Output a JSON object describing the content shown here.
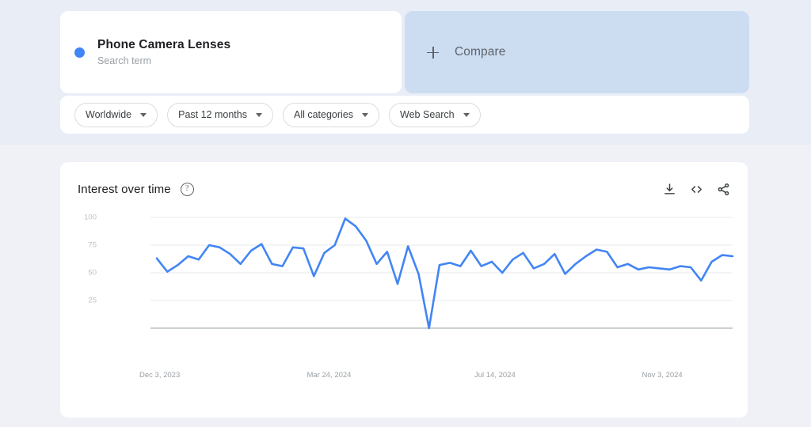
{
  "search_term": {
    "title": "Phone Camera Lenses",
    "subtitle": "Search term",
    "dot_color": "#4285f4"
  },
  "compare": {
    "label": "Compare",
    "icon": "plus-icon"
  },
  "filters": [
    {
      "label": "Worldwide"
    },
    {
      "label": "Past 12 months"
    },
    {
      "label": "All categories"
    },
    {
      "label": "Web Search"
    }
  ],
  "chart_card": {
    "title": "Interest over time",
    "help_glyph": "?",
    "actions": [
      {
        "name": "download-icon"
      },
      {
        "name": "embed-icon"
      },
      {
        "name": "share-icon"
      }
    ]
  },
  "chart_data": {
    "type": "line",
    "title": "Interest over time",
    "xlabel": "",
    "ylabel": "",
    "ylim": [
      0,
      100
    ],
    "grid": true,
    "legend_position": "none",
    "line_color": "#4285f4",
    "y_ticks": [
      100,
      75,
      50,
      25
    ],
    "x_ticks": [
      "Dec 3, 2023",
      "Mar 24, 2024",
      "Jul 14, 2024",
      "Nov 3, 2024"
    ],
    "x_tick_index": [
      0,
      16,
      32,
      48
    ],
    "series": [
      {
        "name": "Phone Camera Lenses",
        "values": [
          63,
          51,
          57,
          65,
          62,
          75,
          73,
          67,
          58,
          70,
          76,
          58,
          56,
          73,
          72,
          47,
          68,
          75,
          99,
          92,
          79,
          58,
          69,
          40,
          74,
          49,
          0,
          57,
          59,
          56,
          70,
          56,
          60,
          50,
          62,
          68,
          54,
          58,
          67,
          49,
          58,
          65,
          71,
          69,
          55,
          58,
          53,
          55,
          54,
          53,
          56,
          55,
          43,
          60,
          66,
          65
        ]
      }
    ]
  }
}
